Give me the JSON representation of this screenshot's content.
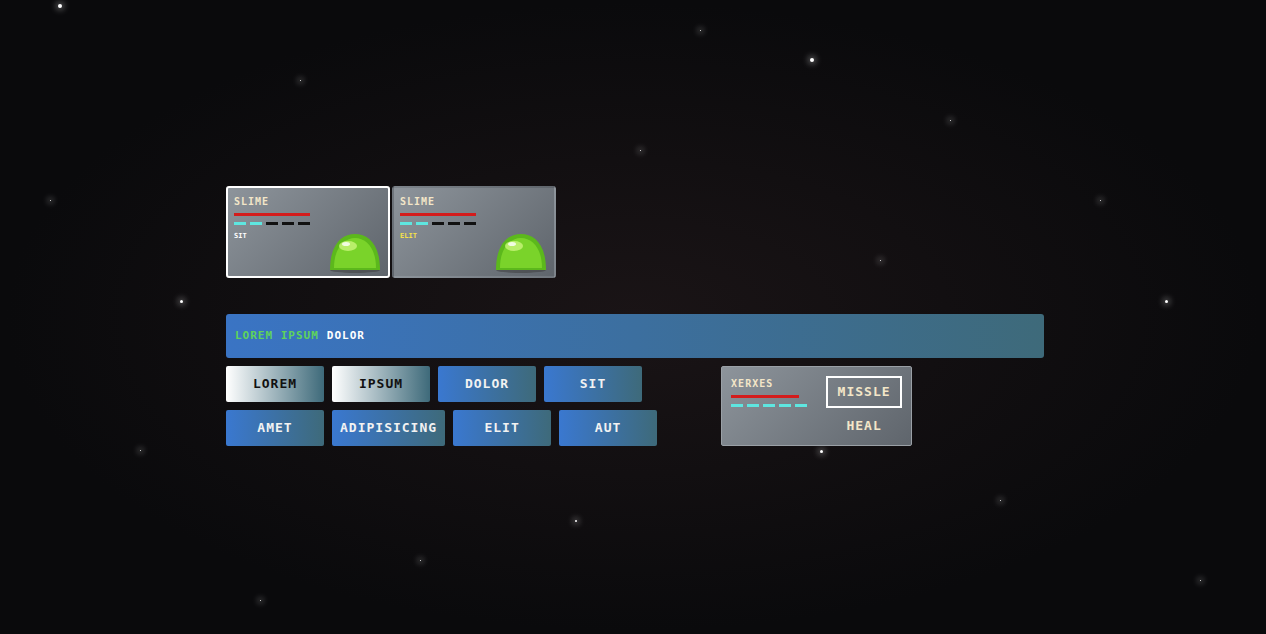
{
  "enemies": [
    {
      "name": "SLIME",
      "selected": true,
      "hp": 1,
      "mana": [
        true,
        true,
        false,
        false,
        false
      ],
      "status": "SIT",
      "color": "#ffffff"
    },
    {
      "name": "SLIME",
      "selected": false,
      "hp": 1,
      "mana": [
        true,
        true,
        false,
        false,
        false
      ],
      "status": "ELIT",
      "color": "#f5e04a"
    }
  ],
  "message": {
    "segments": [
      {
        "text": "LOREM IPSUM",
        "color": "#5fd35a"
      },
      {
        "text": "DOLOR",
        "color": "#ffffff"
      }
    ]
  },
  "commands": [
    [
      {
        "label": "LOREM",
        "highlighted": true
      },
      {
        "label": "IPSUM",
        "highlighted": true
      },
      {
        "label": "DOLOR",
        "highlighted": false
      },
      {
        "label": "SIT",
        "highlighted": false
      }
    ],
    [
      {
        "label": "AMET",
        "highlighted": false
      },
      {
        "label": "ADIPISICING",
        "highlighted": false
      },
      {
        "label": "ELIT",
        "highlighted": false
      },
      {
        "label": "AUT",
        "highlighted": false
      }
    ]
  ],
  "player": {
    "name": "XERXES",
    "hp": 1,
    "mana": [
      true,
      true,
      true,
      true,
      true
    ],
    "actions": [
      {
        "label": "MISSLE",
        "selected": true
      },
      {
        "label": "HEAL",
        "selected": false
      }
    ]
  }
}
